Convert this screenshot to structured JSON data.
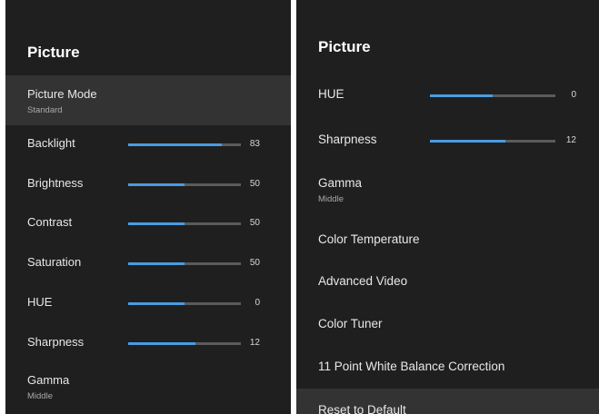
{
  "left_panel": {
    "title": "Picture",
    "picture_mode": {
      "label": "Picture Mode",
      "value": "Standard"
    },
    "sliders": [
      {
        "label": "Backlight",
        "value": "83",
        "level": 0.83
      },
      {
        "label": "Brightness",
        "value": "50",
        "level": 0.5
      },
      {
        "label": "Contrast",
        "value": "50",
        "level": 0.5
      },
      {
        "label": "Saturation",
        "value": "50",
        "level": 0.5
      },
      {
        "label": "HUE",
        "value": "0",
        "level": 0.5
      },
      {
        "label": "Sharpness",
        "value": "12",
        "level": 0.6
      }
    ],
    "gamma": {
      "label": "Gamma",
      "value": "Middle"
    }
  },
  "right_panel": {
    "title": "Picture",
    "sliders": [
      {
        "label": "HUE",
        "value": "0",
        "level": 0.5
      },
      {
        "label": "Sharpness",
        "value": "12",
        "level": 0.6
      }
    ],
    "gamma": {
      "label": "Gamma",
      "value": "Middle"
    },
    "items": [
      {
        "label": "Color Temperature"
      },
      {
        "label": "Advanced Video"
      },
      {
        "label": "Color Tuner"
      },
      {
        "label": "11 Point White Balance Correction"
      },
      {
        "label": "Reset to Default"
      }
    ]
  },
  "colors": {
    "panel_bg": "#1f1f1f",
    "selected_bg": "#333333",
    "slider_fill": "#4a9ce0",
    "slider_track": "#5b5b5b"
  }
}
